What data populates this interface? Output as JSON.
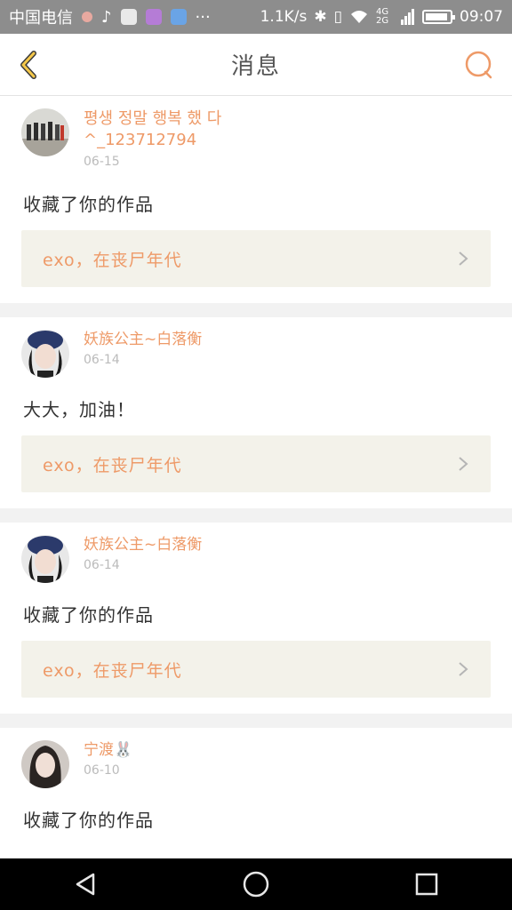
{
  "status_bar": {
    "carrier": "中国电信",
    "speed": "1.1K/s",
    "network": "4G 2G",
    "time": "09:07",
    "dots": "···"
  },
  "header": {
    "title": "消息"
  },
  "colors": {
    "accent": "#ee9a68",
    "link_bg": "#f3f2ea",
    "date": "#bbbbbb"
  },
  "messages": [
    {
      "username": "평생 정말 행복 했 다",
      "username_line2": "^_123712794",
      "date": "06-15",
      "text": "收藏了你的作品",
      "work_title": "exo，在丧尸年代"
    },
    {
      "username": "妖族公主~白落衡",
      "date": "06-14",
      "text": "大大，加油！",
      "work_title": "exo，在丧尸年代"
    },
    {
      "username": "妖族公主~白落衡",
      "date": "06-14",
      "text": "收藏了你的作品",
      "work_title": "exo，在丧尸年代"
    },
    {
      "username": "宁渡🐰",
      "date": "06-10",
      "text": "收藏了你的作品"
    }
  ]
}
